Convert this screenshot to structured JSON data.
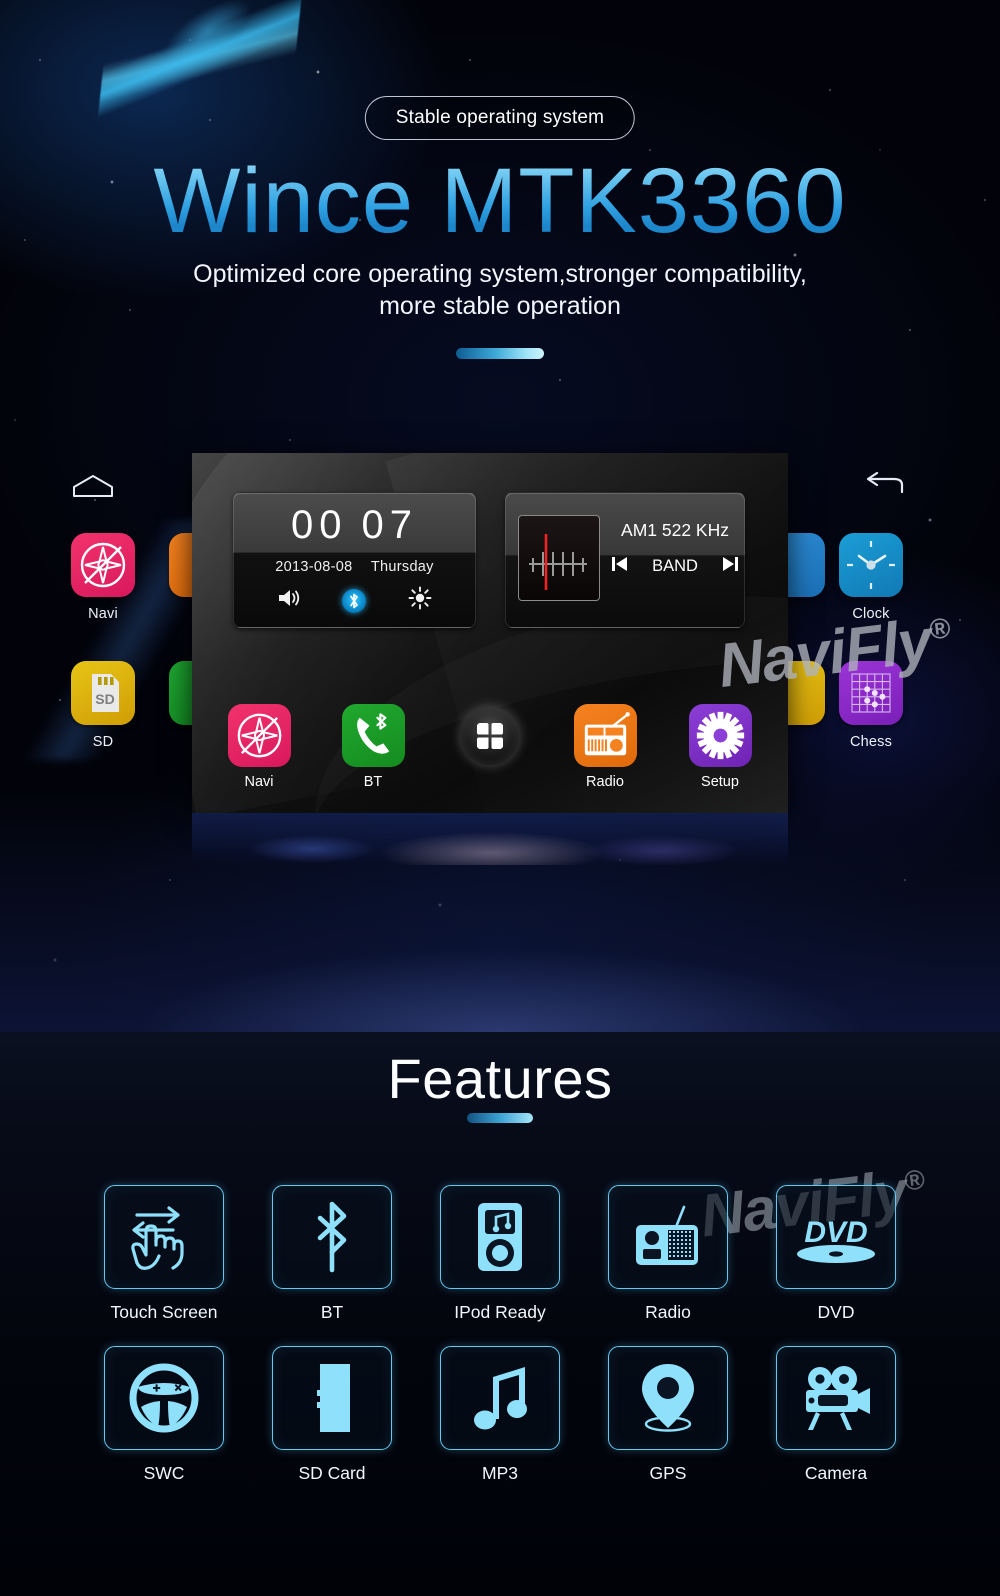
{
  "hero": {
    "badge": "Stable operating system",
    "title": "Wince MTK3360",
    "subtitle_line1": "Optimized core operating system,stronger compatibility,",
    "subtitle_line2": "more stable operation",
    "accent_color": "#3ea9d8"
  },
  "watermark": {
    "brand": "NaviFly",
    "registered": "®"
  },
  "os": {
    "nav": {
      "home": "home-icon",
      "back": "back-icon"
    },
    "left_apps": [
      {
        "label": "Navi",
        "icon": "compass-icon",
        "color": "#f2336d"
      },
      {
        "label": "SD",
        "icon": "sd-card-icon",
        "color": "#e8c516"
      }
    ],
    "right_apps": [
      {
        "label": "Clock",
        "icon": "analog-clock-icon",
        "color": "#1b9ed6"
      },
      {
        "label": "Chess",
        "icon": "chess-board-icon",
        "color": "#9b34d6"
      }
    ],
    "clock_widget": {
      "hours": "00",
      "minutes": "07",
      "date": "2013-08-08",
      "weekday": "Thursday",
      "icons": [
        "volume-icon",
        "bluetooth-icon",
        "brightness-icon"
      ]
    },
    "radio_widget": {
      "frequency": "AM1 522 KHz",
      "band_label": "BAND",
      "prev": "prev-track-icon",
      "next": "next-track-icon"
    },
    "dock": [
      {
        "label": "Navi",
        "icon": "compass-icon",
        "color": "#f2336d"
      },
      {
        "label": "BT",
        "icon": "phone-bt-icon",
        "color": "#21a82f"
      },
      {
        "label": "",
        "icon": "apps-menu-icon",
        "color": "#1c1c1c"
      },
      {
        "label": "Radio",
        "icon": "radio-icon",
        "color": "#f58220"
      },
      {
        "label": "Setup",
        "icon": "gear-icon",
        "color": "#8b3fd6"
      }
    ]
  },
  "features": {
    "title": "Features",
    "accent_color": "#3aa3d4",
    "items": [
      {
        "label": "Touch Screen",
        "icon": "touch-gesture-icon"
      },
      {
        "label": "BT",
        "icon": "bluetooth-icon"
      },
      {
        "label": "IPod Ready",
        "icon": "ipod-icon"
      },
      {
        "label": "Radio",
        "icon": "radio-icon"
      },
      {
        "label": "DVD",
        "icon": "dvd-disc-icon"
      },
      {
        "label": "SWC",
        "icon": "steering-wheel-icon"
      },
      {
        "label": "SD Card",
        "icon": "sd-card-icon"
      },
      {
        "label": "MP3",
        "icon": "music-note-icon"
      },
      {
        "label": "GPS",
        "icon": "map-pin-icon"
      },
      {
        "label": "Camera",
        "icon": "movie-camera-icon"
      }
    ]
  }
}
